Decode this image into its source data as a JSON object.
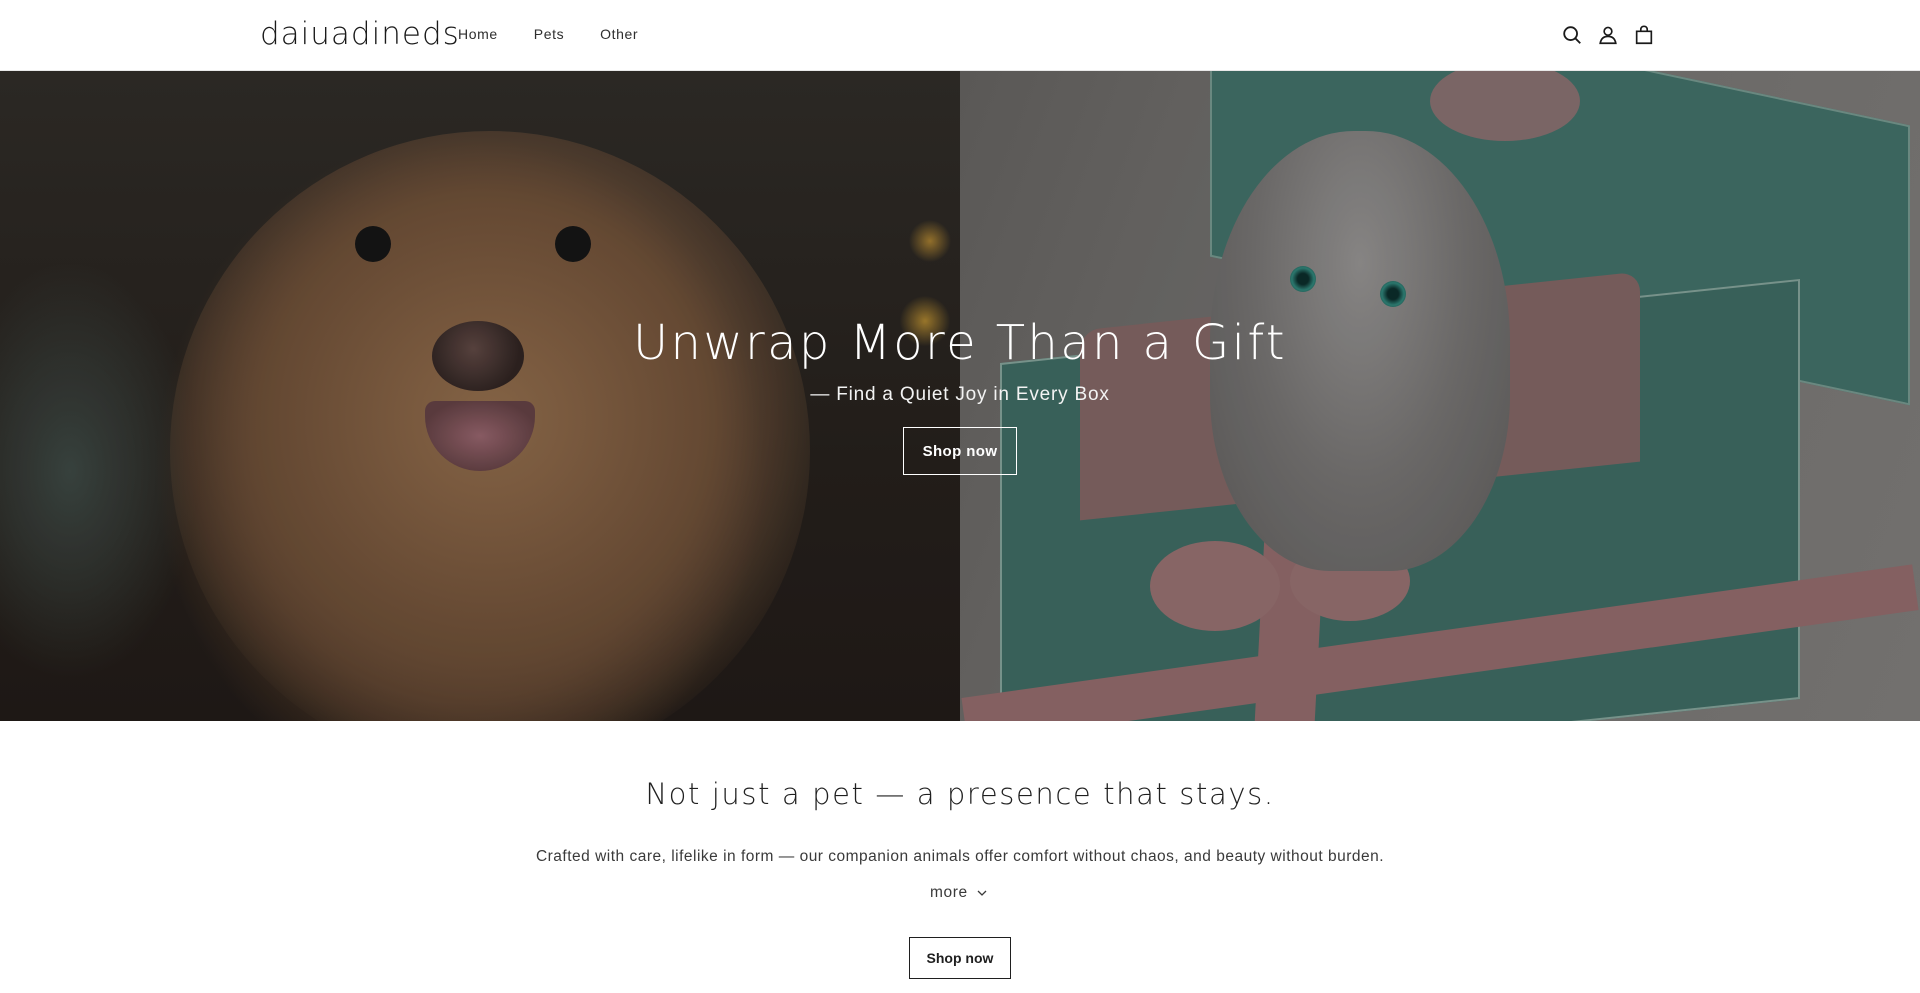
{
  "header": {
    "logo": "daiuadineds",
    "nav": [
      {
        "label": "Home"
      },
      {
        "label": "Pets"
      },
      {
        "label": "Other"
      }
    ],
    "icons": [
      "search-icon",
      "account-icon",
      "cart-icon"
    ]
  },
  "hero": {
    "title": "Unwrap More Than a Gift",
    "subtitle": "— Find a Quiet Joy in Every Box",
    "button_label": "Shop now"
  },
  "section": {
    "heading": "Not just a pet — a presence that stays.",
    "text": "Crafted with care, lifelike in form — our companion animals offer comfort without chaos, and beauty without burden.",
    "more_label": "more",
    "button_label": "Shop now"
  },
  "colors": {
    "text": "#121212",
    "background": "#ffffff",
    "hero_text": "#ffffff"
  }
}
